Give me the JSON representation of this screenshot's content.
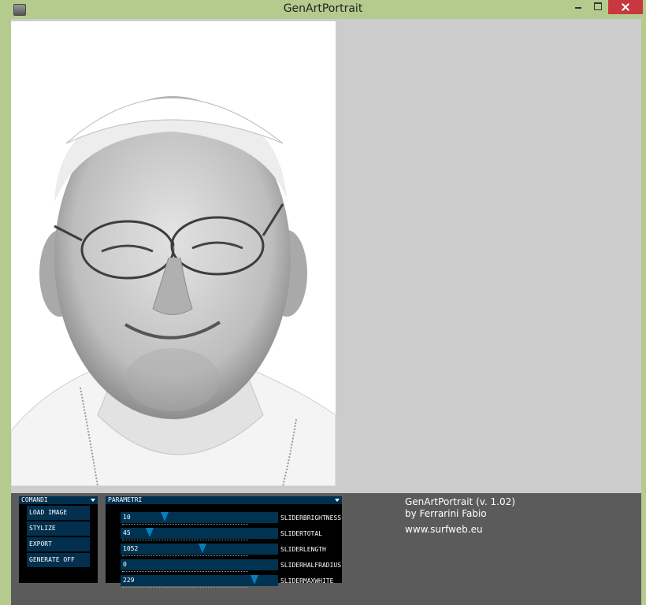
{
  "window": {
    "title": "GenArtPortrait"
  },
  "comandi": {
    "header": "COMANDI",
    "buttons": [
      "LOAD IMAGE",
      "STYLIZE",
      "EXPORT",
      "GENERATE OFF"
    ]
  },
  "parametri": {
    "header": "PARAMETRI",
    "sliders": [
      {
        "label": "SLIDERBRIGHTNESS",
        "value": "10",
        "fraction": 0.27
      },
      {
        "label": "SLIDERTOTAL",
        "value": "45",
        "fraction": 0.17
      },
      {
        "label": "SLIDERLENGTH",
        "value": "1052",
        "fraction": 0.52
      },
      {
        "label": "SLIDERHALFRADIUS",
        "value": "0",
        "fraction": 0.0
      },
      {
        "label": "SLIDERMAXWHITE",
        "value": "229",
        "fraction": 0.87
      }
    ]
  },
  "info": {
    "line1": "GenArtPortrait  (v. 1.02)",
    "line2": "by Ferrarini Fabio",
    "line3": "www.surfweb.eu"
  },
  "colors": {
    "frame": "#b5cb8d",
    "close": "#c7383f",
    "panel": "#5b5b5b",
    "control": "#003352",
    "handle": "#0a7cba"
  }
}
